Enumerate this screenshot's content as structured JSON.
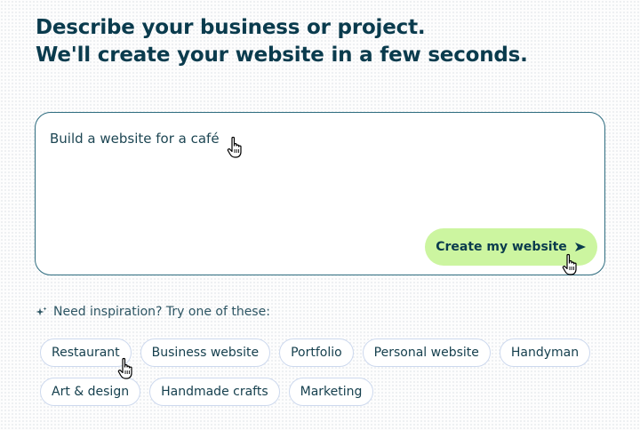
{
  "headline": {
    "line1": "Describe your business or project.",
    "line2": "We'll create your website in a few seconds."
  },
  "prompt": {
    "value": "Build a website for a café"
  },
  "create_button": {
    "label": "Create my website",
    "icon": "send-arrow-icon"
  },
  "inspiration": {
    "icon": "sparkle-icon",
    "label": "Need inspiration? Try one of these:"
  },
  "chips_row1": [
    "Restaurant",
    "Business website",
    "Portfolio",
    "Personal website",
    "Handyman"
  ],
  "chips_row2": [
    "Art & design",
    "Handmade crafts",
    "Marketing"
  ],
  "colors": {
    "heading": "#0a3b4d",
    "button_bg": "#ccf5a0",
    "box_border": "#2f6d80",
    "chip_border": "#cdd9ee"
  }
}
